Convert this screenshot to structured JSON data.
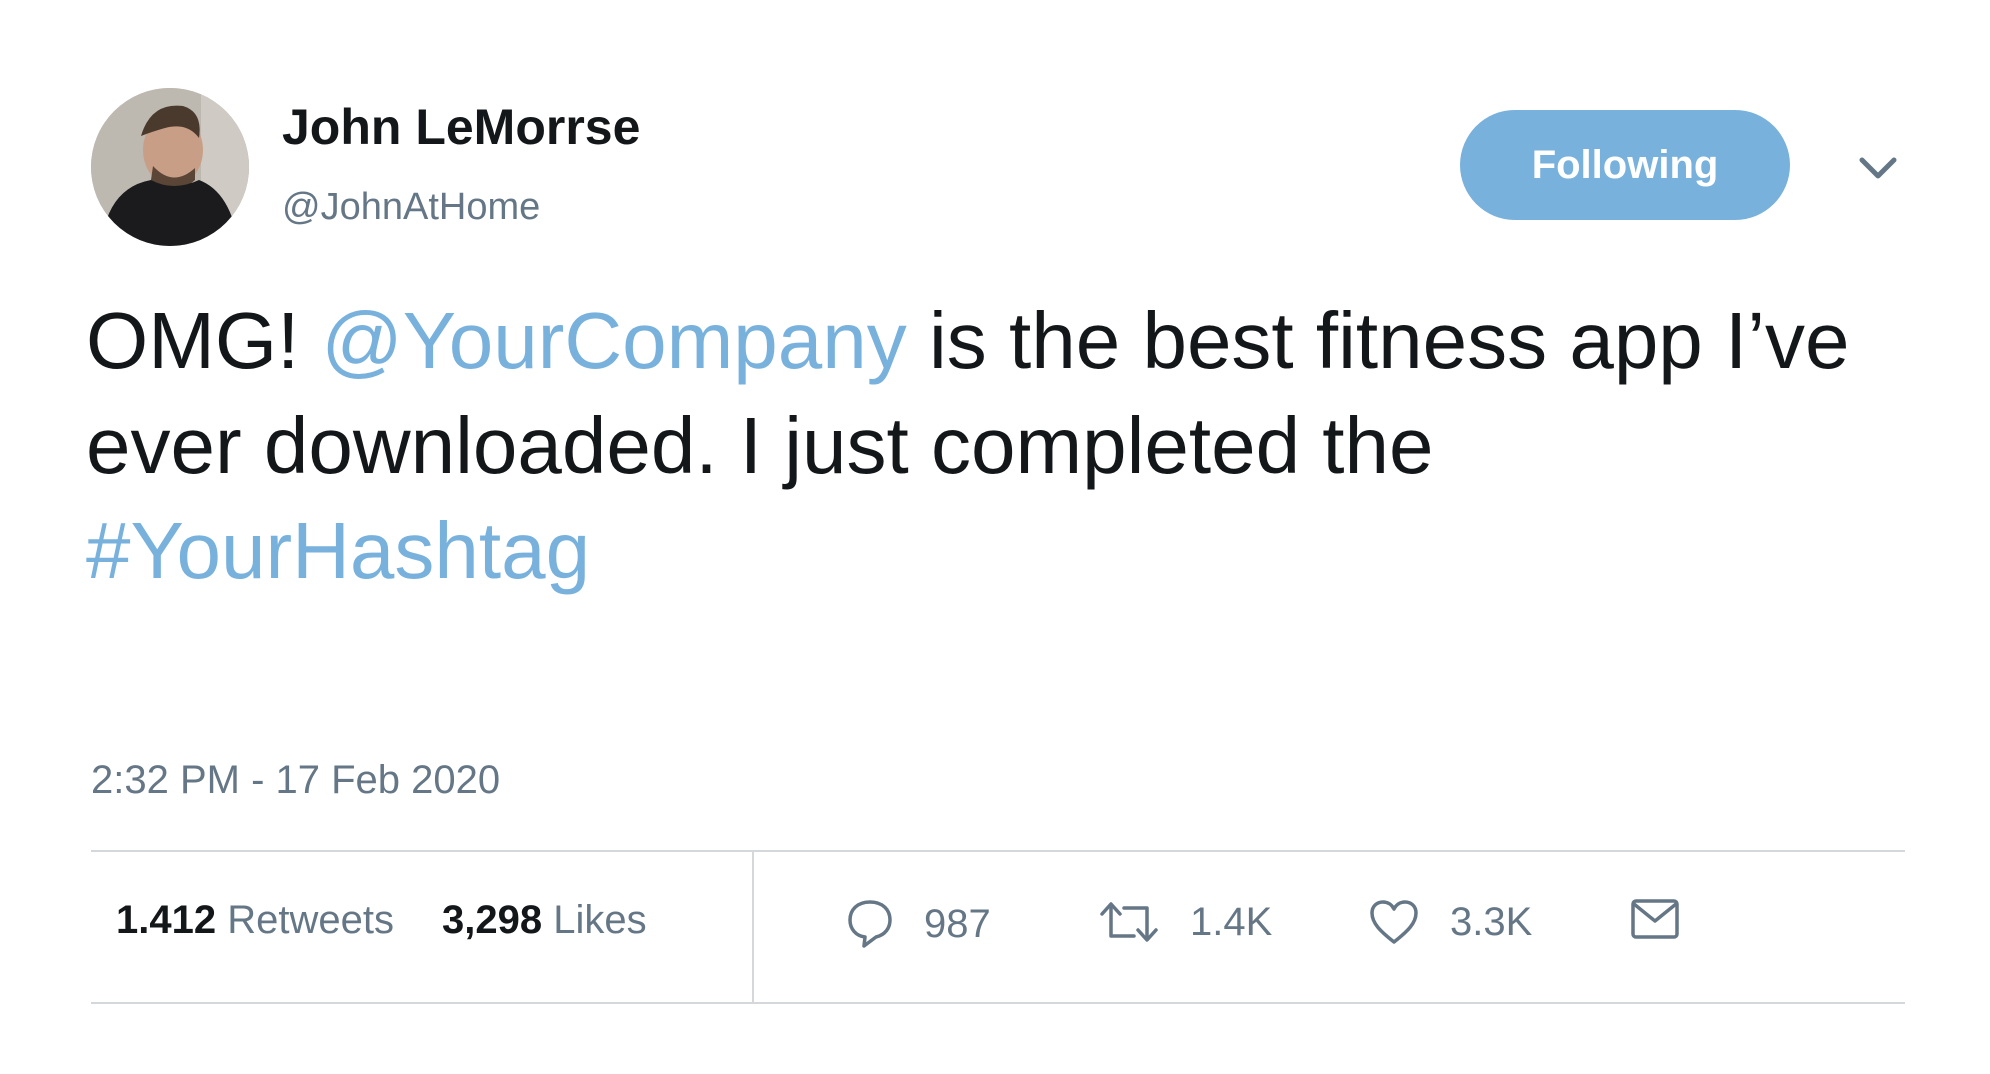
{
  "author": {
    "display_name": "John LeMorrse",
    "handle": "@JohnAtHome"
  },
  "follow_button": {
    "label": "Following"
  },
  "tweet": {
    "text_part1": "OMG! ",
    "mention": "@YourCompany",
    "text_part2": " is the best fitness app I’ve ever downloaded. I just completed the ",
    "hashtag": "#YourHashtag",
    "timestamp": "2:32 PM - 17 Feb 2020"
  },
  "stats": {
    "retweets_count": "1.412",
    "retweets_label": "Retweets",
    "likes_count": "3,298",
    "likes_label": "Likes"
  },
  "actions": {
    "reply_count": "987",
    "retweet_count": "1.4K",
    "like_count": "3.3K"
  },
  "colors": {
    "accent": "#79b1dd",
    "text": "#14171a",
    "secondary_text": "#657786",
    "divider": "#d4d8db"
  },
  "icons": [
    "chevron-down-icon",
    "reply-icon",
    "retweet-icon",
    "heart-icon",
    "mail-icon"
  ]
}
